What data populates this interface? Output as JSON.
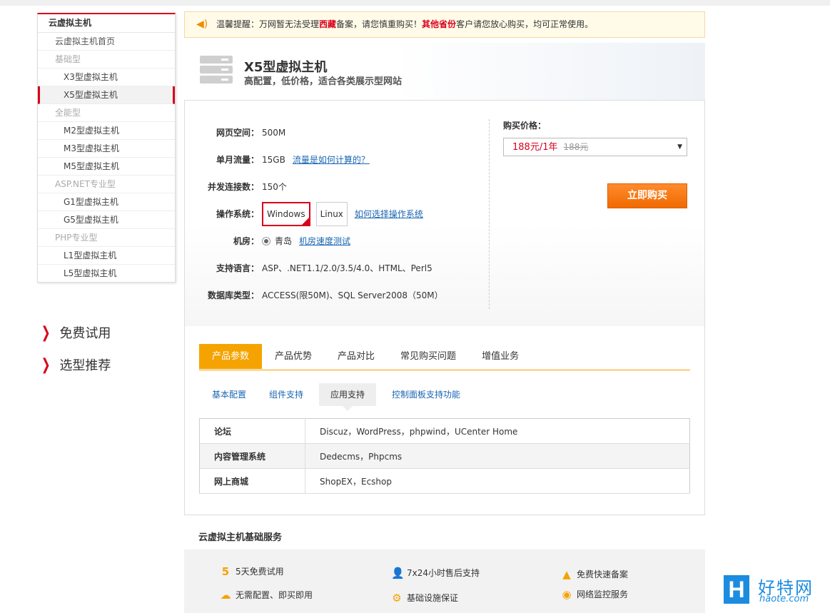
{
  "sidebar": {
    "title": "云虚拟主机",
    "items": [
      {
        "label": "云虚拟主机首页",
        "kind": "lvl1"
      },
      {
        "label": "基础型",
        "kind": "cat"
      },
      {
        "label": "X3型虚拟主机",
        "kind": "lvl2"
      },
      {
        "label": "X5型虚拟主机",
        "kind": "lvl2",
        "active": true
      },
      {
        "label": "全能型",
        "kind": "cat"
      },
      {
        "label": "M2型虚拟主机",
        "kind": "lvl2"
      },
      {
        "label": "M3型虚拟主机",
        "kind": "lvl2"
      },
      {
        "label": "M5型虚拟主机",
        "kind": "lvl2"
      },
      {
        "label": "ASP.NET专业型",
        "kind": "cat"
      },
      {
        "label": "G1型虚拟主机",
        "kind": "lvl2"
      },
      {
        "label": "G5型虚拟主机",
        "kind": "lvl2"
      },
      {
        "label": "PHP专业型",
        "kind": "cat"
      },
      {
        "label": "L1型虚拟主机",
        "kind": "lvl2"
      },
      {
        "label": "L5型虚拟主机",
        "kind": "lvl2"
      }
    ],
    "links": [
      "免费试用",
      "选型推荐"
    ]
  },
  "notice": {
    "prefix": "温馨提醒：万网暂无法受理",
    "red1": "西藏",
    "mid": "备案，请您慎重购买！",
    "red2": "其他省份",
    "suffix": "客户请您放心购买，均可正常使用。"
  },
  "product": {
    "title": "X5型虚拟主机",
    "subtitle": "高配置，低价格，适合各类展示型网站"
  },
  "specs": {
    "space_label": "网页空间：",
    "space_value": "500M",
    "traffic_label": "单月流量：",
    "traffic_value": "15GB",
    "traffic_link": "流量是如何计算的？",
    "conn_label": "并发连接数：",
    "conn_value": "150个",
    "os_label": "操作系统：",
    "os_options": [
      "Windows",
      "Linux"
    ],
    "os_selected": "Windows",
    "os_link": "如何选择操作系统",
    "room_label": "机房：",
    "room_value": "青岛",
    "room_link": "机房速度测试",
    "lang_label": "支持语言：",
    "lang_value": "ASP、.NET1.1/2.0/3.5/4.0、HTML、Perl5",
    "db_label": "数据库类型：",
    "db_value": "ACCESS(限50M)、SQL Server2008（50M）"
  },
  "purchase": {
    "label": "购买价格：",
    "price": "188元/1年",
    "old_price": "188元",
    "buy_button": "立即购买"
  },
  "tabs": [
    "产品参数",
    "产品优势",
    "产品对比",
    "常见购买问题",
    "增值业务"
  ],
  "subtabs": [
    "基本配置",
    "组件支持",
    "应用支持",
    "控制面板支持功能"
  ],
  "params": [
    {
      "key": "论坛",
      "value": "Discuz，WordPress，phpwind，UCenter Home"
    },
    {
      "key": "内容管理系统",
      "value": "Dedecms，Phpcms"
    },
    {
      "key": "网上商城",
      "value": "ShopEX，Ecshop"
    }
  ],
  "services": {
    "title": "云虚拟主机基础服务",
    "items": [
      {
        "label": "5天免费试用",
        "icon": "five-icon",
        "glyph": "5"
      },
      {
        "label": "7x24小时售后支持",
        "icon": "user-icon",
        "glyph": "👤"
      },
      {
        "label": "免费快速备案",
        "icon": "rocket-icon",
        "glyph": "▲"
      },
      {
        "label": "无需配置、即买即用",
        "icon": "cloud-icon",
        "glyph": "☁"
      },
      {
        "label": "基础设施保证",
        "icon": "gear-icon",
        "glyph": "⚙"
      },
      {
        "label": "网络监控服务",
        "icon": "eye-icon",
        "glyph": "◉"
      }
    ]
  },
  "watermark": {
    "cn": "好特网",
    "en": "haote.com",
    "letter": "H"
  }
}
